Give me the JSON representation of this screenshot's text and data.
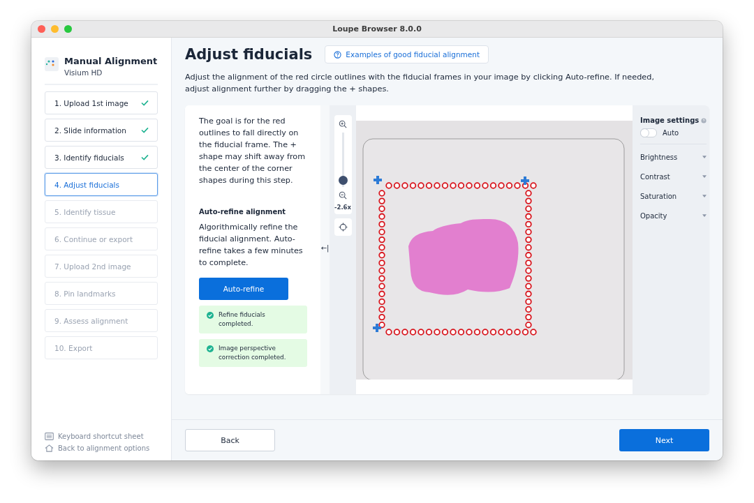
{
  "window": {
    "title": "Loupe Browser 8.0.0"
  },
  "sidebar": {
    "title": "Manual Alignment",
    "subtitle": "Visium HD",
    "steps": [
      {
        "label": "1. Upload 1st image",
        "completed": true,
        "selected": false,
        "disabled": false
      },
      {
        "label": "2. Slide information",
        "completed": true,
        "selected": false,
        "disabled": false
      },
      {
        "label": "3. Identify fiducials",
        "completed": true,
        "selected": false,
        "disabled": false
      },
      {
        "label": "4. Adjust fiducials",
        "completed": false,
        "selected": true,
        "disabled": false
      },
      {
        "label": "5. Identify tissue",
        "completed": false,
        "selected": false,
        "disabled": true
      },
      {
        "label": "6. Continue or export",
        "completed": false,
        "selected": false,
        "disabled": true
      },
      {
        "label": "7. Upload 2nd image",
        "completed": false,
        "selected": false,
        "disabled": true
      },
      {
        "label": "8. Pin landmarks",
        "completed": false,
        "selected": false,
        "disabled": true
      },
      {
        "label": "9. Assess alignment",
        "completed": false,
        "selected": false,
        "disabled": true
      },
      {
        "label": "10. Export",
        "completed": false,
        "selected": false,
        "disabled": true
      }
    ],
    "links": [
      {
        "kind": "keyboard",
        "label": "Keyboard shortcut sheet"
      },
      {
        "kind": "home",
        "label": "Back to alignment options"
      }
    ]
  },
  "header": {
    "title": "Adjust fiducials",
    "help_link": "Examples of good fiducial alignment",
    "description": "Adjust the alignment of the red circle outlines with the fiducial frames in your image by clicking Auto-refine. If needed, adjust alignment further by dragging the + shapes."
  },
  "guide": {
    "intro": "The goal is for the red outlines to fall directly on the fiducial frame. The + shape may shift away from the center of the corner shapes during this step.",
    "section_title": "Auto-refine alignment",
    "section_text": "Algorithmically refine the fiducial alignment. Auto-refine takes a few minutes to complete.",
    "button": "Auto-refine",
    "notices": [
      "Refine fiducials completed.",
      "Image perspective correction completed."
    ],
    "collapse_icon": "←|"
  },
  "zoom": {
    "level": 0.05,
    "reading": "-2.6x"
  },
  "image_settings": {
    "title": "Image settings",
    "auto": {
      "label": "Auto",
      "on": false
    },
    "dropdowns": [
      "Brightness",
      "Contrast",
      "Saturation",
      "Opacity"
    ]
  },
  "footer": {
    "back": "Back",
    "next": "Next"
  }
}
